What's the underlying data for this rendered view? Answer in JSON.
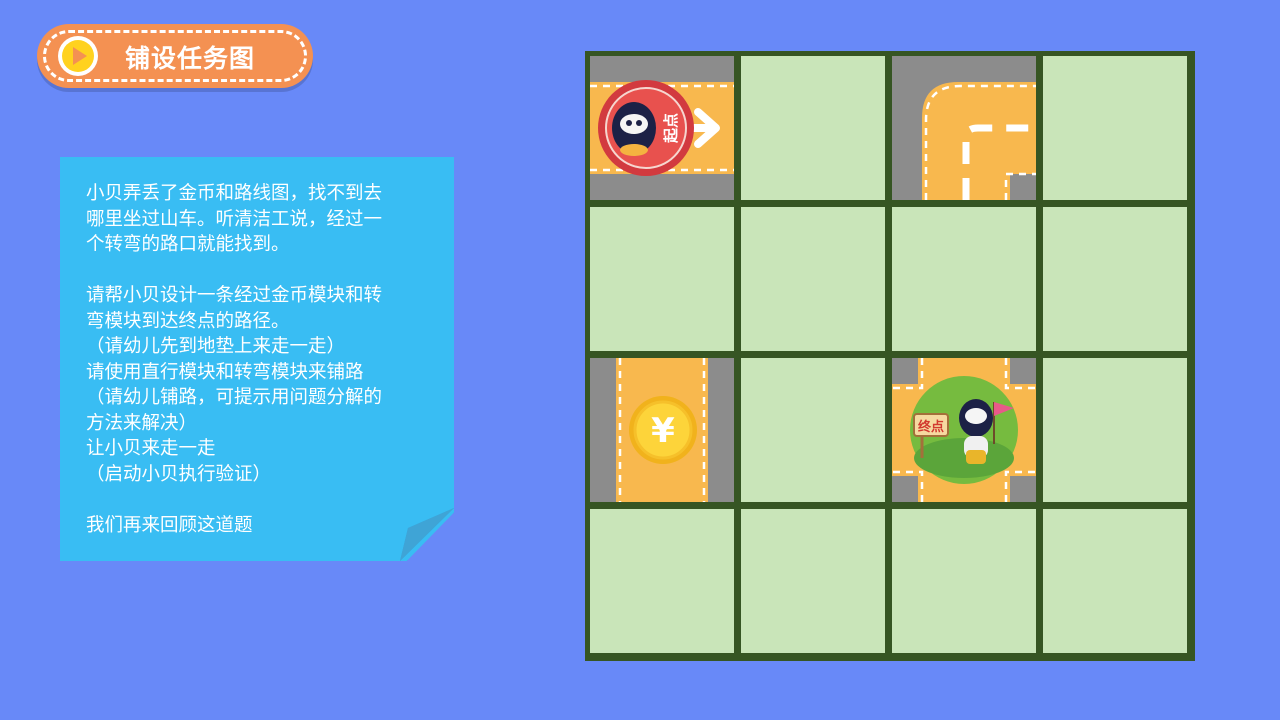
{
  "header": {
    "title": "铺设任务图",
    "play_icon": "play-icon",
    "colors": {
      "pill": "#f49152",
      "play_circle": "#ffd21f"
    }
  },
  "note": {
    "lines": [
      "小贝弄丢了金币和路线图，找不到去",
      "哪里坐过山车。听清洁工说，经过一",
      "个转弯的路口就能找到。",
      "",
      "请帮小贝设计一条经过金币模块和转",
      "弯模块到达终点的路径。",
      "（请幼儿先到地垫上来走一走）",
      "请使用直行模块和转弯模块来铺路",
      "（请幼儿铺路，可提示用问题分解的",
      "方法来解决）",
      "让小贝来走一走",
      "（启动小贝执行验证）",
      "",
      "我们再来回顾这道题"
    ],
    "color": "#39bdf3"
  },
  "board": {
    "rows": 4,
    "cols": 4,
    "colors": {
      "grid_line": "#365523",
      "empty_cell": "#c9e5b9",
      "road": "#f8b84e",
      "asphalt": "#8c8c8c"
    },
    "tiles": [
      {
        "row": 0,
        "col": 0,
        "type": "start",
        "label": "起点",
        "icon": "robot-start-badge-icon"
      },
      {
        "row": 0,
        "col": 2,
        "type": "turn",
        "icon": "turn-road-icon"
      },
      {
        "row": 2,
        "col": 0,
        "type": "coin",
        "label": "¥",
        "icon": "coin-icon"
      },
      {
        "row": 2,
        "col": 2,
        "type": "end",
        "label": "终点",
        "icon": "robot-end-badge-icon"
      }
    ]
  }
}
